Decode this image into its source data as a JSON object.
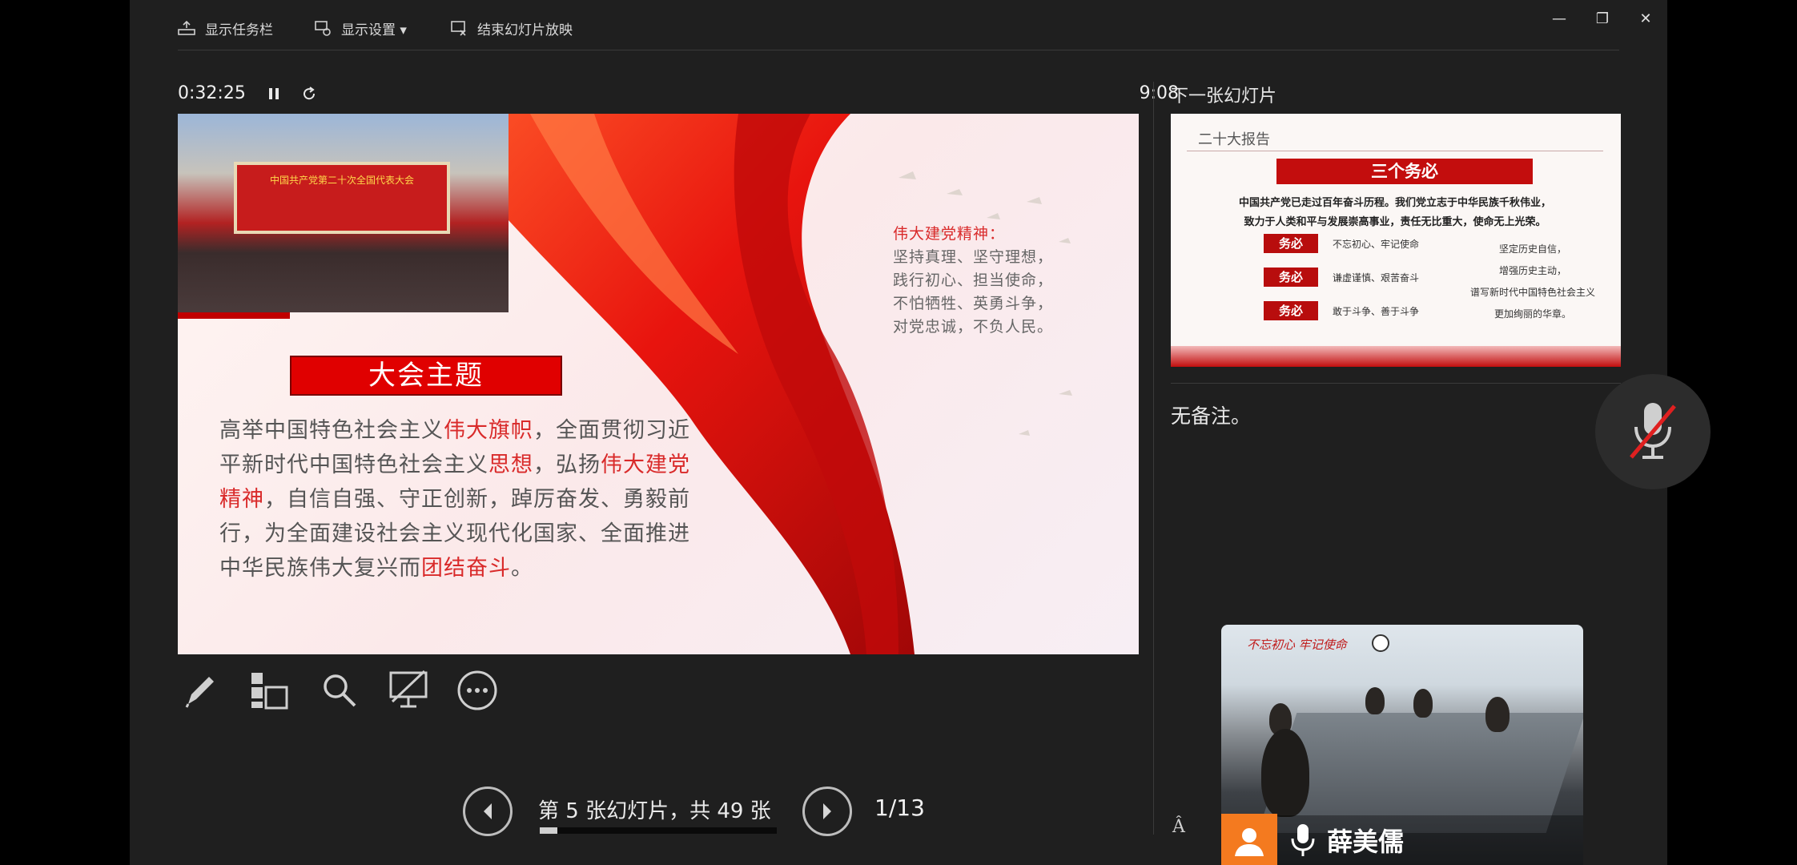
{
  "topbar": {
    "show_taskbar": "显示任务栏",
    "display_settings": "显示设置 ▾",
    "end_slideshow": "结束幻灯片放映"
  },
  "timer": {
    "elapsed": "0:32:25",
    "clock": "9:08"
  },
  "slide": {
    "hall_banner": "中国共产党第二十次全国代表大会",
    "theme_title": "大会主题",
    "theme_segments": [
      {
        "t": "高举中国特色社会主义",
        "hl": false
      },
      {
        "t": "伟大旗帜",
        "hl": true
      },
      {
        "t": "，全面贯彻习近平新时代中国特色社会主义",
        "hl": false
      },
      {
        "t": "思想",
        "hl": true
      },
      {
        "t": "，弘扬",
        "hl": false
      },
      {
        "t": "伟大建党精神",
        "hl": true
      },
      {
        "t": "，自信自强、守正创新，踔厉奋发、勇毅前行，为全面建设社会主义现代化国家、全面推进中华民族伟大复兴而",
        "hl": false
      },
      {
        "t": "团结奋斗",
        "hl": true
      },
      {
        "t": "。",
        "hl": false
      }
    ],
    "spirit_title": "伟大建党精神：",
    "spirit_lines": [
      "坚持真理、坚守理想，",
      "践行初心、担当使命，",
      "不怕牺牲、英勇斗争，",
      "对党忠诚，不负人民。"
    ]
  },
  "tools": [
    "pen-tool",
    "all-slides",
    "zoom",
    "black-screen",
    "more-options"
  ],
  "nav": {
    "slide_counter": "第 5 张幻灯片，共 49 张",
    "progress_fraction": 0.075,
    "page_indicator": "1/13"
  },
  "next_slide": {
    "label": "下一张幻灯片",
    "header": "二十大报告",
    "title": "三个务必",
    "line1": "中国共产党已走过百年奋斗历程。我们党立志于中华民族千秋伟业，",
    "line2": "致力于人类和平与发展崇高事业，责任无比重大，使命无上光荣。",
    "tag": "务必",
    "items": [
      "不忘初心、牢记使命",
      "谦虚谨慎、艰苦奋斗",
      "敢于斗争、善于斗争"
    ],
    "right_lines": [
      "坚定历史自信，",
      "增强历史主动，",
      "谱写新时代中国特色社会主义",
      "更加绚丽的华章。"
    ]
  },
  "notes": {
    "text": "无备注。"
  },
  "video": {
    "banner": "不忘初心  牢记使命",
    "participant_name": "薛美儒"
  },
  "colors": {
    "accent_red": "#e00000",
    "background": "#1f1f1f",
    "avatar": "#f47a1f"
  }
}
